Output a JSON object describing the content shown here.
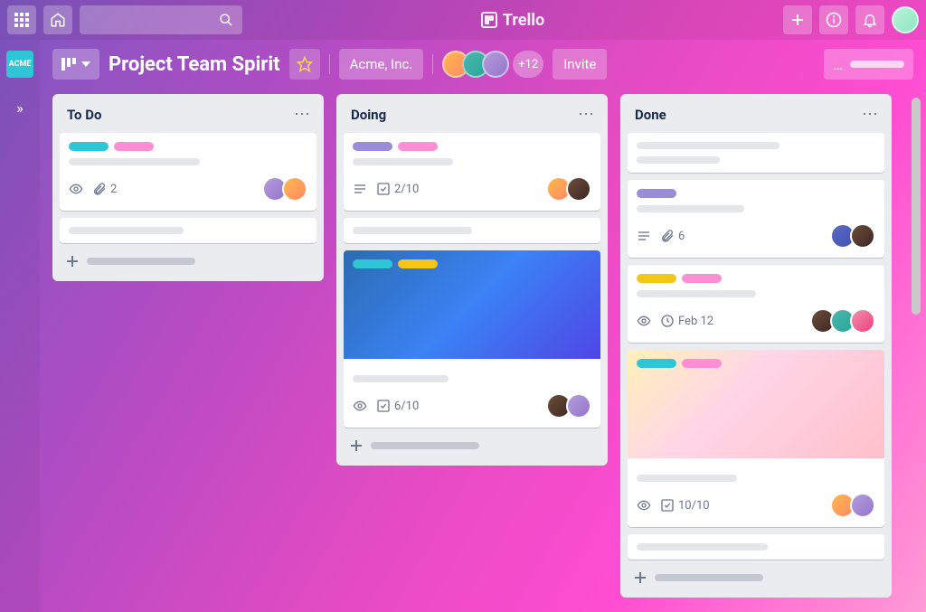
{
  "app": {
    "brand": "Trello"
  },
  "workspace": {
    "badge": "ACME"
  },
  "board": {
    "title": "Project Team Spirit",
    "team": "Acme, Inc.",
    "more_members": "+12",
    "invite_label": "Invite",
    "menu_dots": "…"
  },
  "lists": [
    {
      "title": "To Do",
      "cards": [
        {
          "labels": [
            "teal",
            "pink"
          ],
          "badges": {
            "attachments": "2"
          },
          "avatars": [
            "av-3",
            "av-1"
          ]
        },
        {
          "labels": [],
          "badges": {},
          "avatars": []
        }
      ]
    },
    {
      "title": "Doing",
      "cards": [
        {
          "labels": [
            "purple",
            "pink"
          ],
          "badges": {
            "checklist": "2/10"
          },
          "avatars": [
            "av-1",
            "av-5"
          ]
        },
        {
          "labels": [],
          "badges": {},
          "avatars": []
        },
        {
          "cover": "blue",
          "cover_labels": [
            "teal",
            "yellow"
          ],
          "badges": {
            "checklist": "6/10"
          },
          "avatars": [
            "av-5",
            "av-3"
          ]
        }
      ]
    },
    {
      "title": "Done",
      "cards": [
        {
          "labels": [],
          "badges": {},
          "avatars": []
        },
        {
          "labels": [
            "purple"
          ],
          "badges": {
            "attachments": "6"
          },
          "avatars": [
            "av-6",
            "av-5"
          ]
        },
        {
          "labels": [
            "yellow",
            "pink"
          ],
          "badges": {
            "due": "Feb 12"
          },
          "avatars": [
            "av-5",
            "av-2",
            "av-4"
          ]
        },
        {
          "cover": "pink",
          "cover_labels": [
            "teal",
            "pink"
          ],
          "badges": {
            "checklist": "10/10"
          },
          "avatars": [
            "av-1",
            "av-3"
          ]
        },
        {
          "labels": [],
          "badges": {},
          "avatars": []
        }
      ]
    }
  ]
}
